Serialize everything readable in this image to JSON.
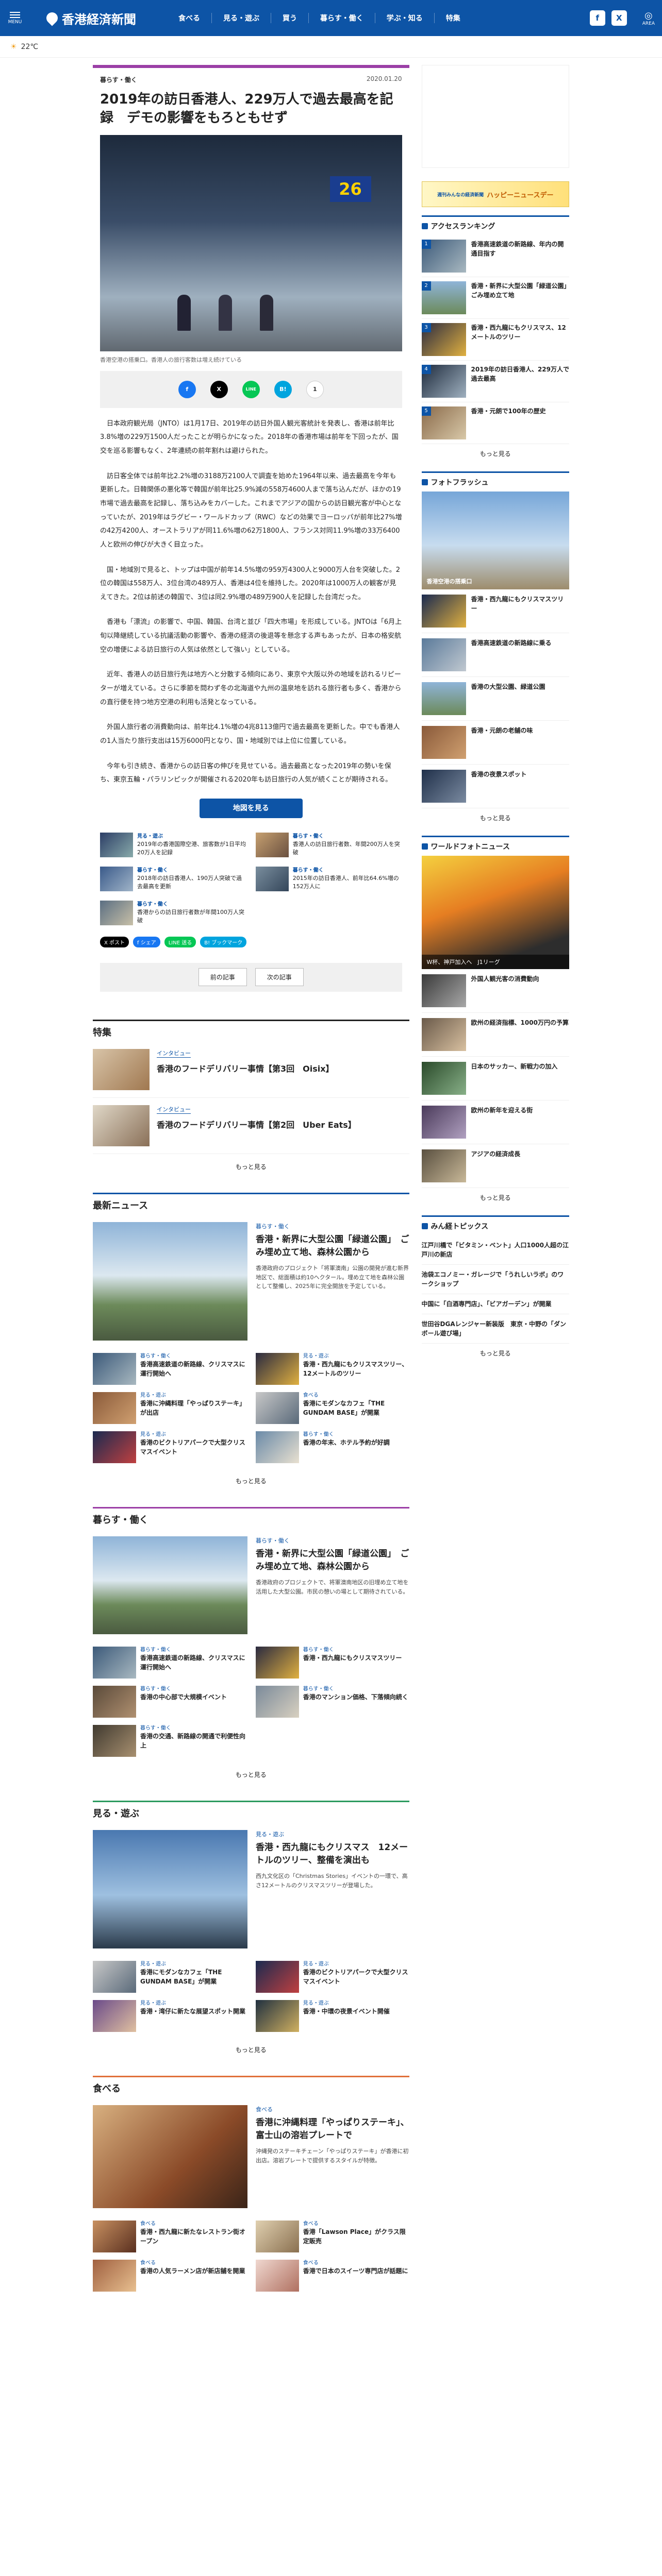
{
  "header": {
    "menu_label": "MENU",
    "site_name": "香港経済新聞",
    "nav": [
      "食べる",
      "見る・遊ぶ",
      "買う",
      "暮らす・働く",
      "学ぶ・知る",
      "特集"
    ],
    "area_label": "AREA"
  },
  "weather": {
    "temp": "22℃"
  },
  "article": {
    "category": "暮らす・働く",
    "date": "2020.01.20",
    "title": "2019年の訪日香港人、229万人で過去最高を記録　デモの影響をもろともせず",
    "caption": "香港空港の搭乗口。香港人の旅行客数は増え続けている",
    "gate_number": "26",
    "share": [
      "f",
      "X",
      "LINE",
      "B!",
      "1"
    ],
    "paragraphs": [
      "日本政府観光局（JNTO）は1月17日、2019年の訪日外国人観光客統計を発表し、香港は前年比3.8%増の229万1500人だったことが明らかになった。2018年の香港市場は前年を下回ったが、国交を巡る影響もなく、2年連続の前年割れは避けられた。",
      "訪日客全体では前年比2.2%増の3188万2100人で調査を始めた1964年以来、過去最高を今年も更新した。日韓関係の悪化等で韓国が前年比25.9%減の558万4600人まで落ち込んだが、ほかの19市場で過去最高を記録し、落ち込みをカバーした。これまでアジアの国からの訪日観光客が中心となっていたが、2019年はラグビー・ワールドカップ（RWC）などの効果でヨーロッパが前年比27%増の42万4200人、オーストラリアが同11.6%増の62万1800人、フランス対同11.9%増の33万6400人と欧州の伸びが大きく目立った。",
      "国・地域別で見ると、トップは中国が前年14.5%増の959万4300人と9000万人台を突破した。2位の韓国は558万人、3位台湾の489万人、香港は4位を維持した。2020年は1000万人の観客が見えてきた。2位は前述の韓国で、3位は同2.9%増の489万900人を記録した台湾だった。",
      "香港も「漂流」の影響で、中国、韓国、台湾と並び「四大市場」を形成している。JNTOは「6月上旬以降継続している抗議活動の影響や、香港の経済の後退等を懸念する声もあったが、日本の格安航空の増便による訪日旅行の人気は依然として強い」としている。",
      "近年、香港人の訪日旅行先は地方へと分散する傾向にあり、東京や大阪以外の地域を訪れるリピーターが増えている。さらに季節を問わず冬の北海道や九州の温泉地を訪れる旅行者も多く、香港からの直行便を持つ地方空港の利用も活発となっている。",
      "外国人旅行者の消費動向は、前年比4.1%増の4兆8113億円で過去最高を更新した。中でも香港人の1人当たり旅行支出は15万6000円となり、国・地域別では上位に位置している。",
      "今年も引き続き、香港からの訪日客の伸びを見せている。過去最高となった2019年の勢いを保ち、東京五輪・パラリンピックが開催される2020年も訪日旅行の人気が続くことが期待される。"
    ],
    "map_button": "地図を見る",
    "related": [
      {
        "k": "見る・遊ぶ",
        "t": "2019年の香港国際空港、旅客数が1日平均20万人を記録"
      },
      {
        "k": "暮らす・働く",
        "t": "香港人の訪日旅行者数、年間200万人を突破"
      },
      {
        "k": "暮らす・働く",
        "t": "2018年の訪日香港人、190万人突破で過去最高を更新"
      },
      {
        "k": "暮らす・働く",
        "t": "2015年の訪日香港人、前年比64.6%増の152万人に"
      },
      {
        "k": "暮らす・働く",
        "t": "香港からの訪日旅行者数が年間100万人突破"
      }
    ],
    "tags": [
      "X ポスト",
      "f シェア",
      "LINE 送る",
      "B! ブックマーク"
    ],
    "prev": "前の記事",
    "next": "次の記事"
  },
  "tokushu": {
    "title": "特集",
    "items": [
      {
        "kw": "インタビュー",
        "head": "香港のフードデリバリー事情【第3回　Oisix】"
      },
      {
        "kw": "インタビュー",
        "head": "香港のフードデリバリー事情【第2回　Uber Eats】"
      }
    ],
    "more": "もっと見る"
  },
  "latest": {
    "title": "最新ニュース",
    "lead": {
      "kw": "暮らす・働く",
      "head": "香港・新界に大型公園「緑道公園」　ごみ埋め立て地、森林公園から",
      "summary": "香港政府のプロジェクト「将軍澳南」公園の開発が進む新界地区で、総面積は約10ヘクタール。埋め立て地を森林公園として整備し、2025年に完全開放を予定している。"
    },
    "items": [
      {
        "k": "暮らす・働く",
        "t": "香港高速鉄道の新路線、クリスマスに運行開始へ"
      },
      {
        "k": "見る・遊ぶ",
        "t": "香港・西九龍にもクリスマスツリー、12メートルのツリー"
      },
      {
        "k": "見る・遊ぶ",
        "t": "香港に沖縄料理「やっぱりステーキ」が出店"
      },
      {
        "k": "食べる",
        "t": "香港にモダンなカフェ「THE GUNDAM BASE」が開業"
      },
      {
        "k": "見る・遊ぶ",
        "t": "香港のビクトリアパークで大型クリスマスイベント"
      },
      {
        "k": "暮らす・働く",
        "t": "香港の年末、ホテル予約が好調"
      }
    ],
    "more": "もっと見る"
  },
  "kurasu": {
    "title": "暮らす・働く",
    "lead": {
      "kw": "暮らす・働く",
      "head": "香港・新界に大型公園「緑道公園」　ごみ埋め立て地、森林公園から",
      "summary": "香港政府のプロジェクトで、将軍澳南地区の旧埋め立て地を活用した大型公園。市民の憩いの場として期待されている。"
    },
    "items": [
      {
        "k": "暮らす・働く",
        "t": "香港高速鉄道の新路線、クリスマスに運行開始へ"
      },
      {
        "k": "暮らす・働く",
        "t": "香港・西九龍にもクリスマスツリー"
      },
      {
        "k": "暮らす・働く",
        "t": "香港の中心部で大規模イベント"
      },
      {
        "k": "暮らす・働く",
        "t": "香港のマンション価格、下落傾向続く"
      },
      {
        "k": "暮らす・働く",
        "t": "香港の交通、新路線の開通で利便性向上"
      }
    ],
    "more": "もっと見る"
  },
  "miru": {
    "title": "見る・遊ぶ",
    "lead": {
      "kw": "見る・遊ぶ",
      "head": "香港・西九龍にもクリスマス　12メートルのツリー、整備を演出も",
      "summary": "西九文化区の「Christmas Stories」イベントの一環で、高さ12メートルのクリスマスツリーが登場した。"
    },
    "items": [
      {
        "k": "見る・遊ぶ",
        "t": "香港にモダンなカフェ「THE GUNDAM BASE」が開業"
      },
      {
        "k": "見る・遊ぶ",
        "t": "香港のビクトリアパークで大型クリスマスイベント"
      },
      {
        "k": "見る・遊ぶ",
        "t": "香港・湾仔に新たな展望スポット開業"
      },
      {
        "k": "見る・遊ぶ",
        "t": "香港・中環の夜景イベント開催"
      }
    ],
    "more": "もっと見る"
  },
  "taberu": {
    "title": "食べる",
    "lead": {
      "kw": "食べる",
      "head": "香港に沖縄料理「やっぱりステーキ」、富士山の溶岩プレートで",
      "summary": "沖縄発のステーキチェーン「やっぱりステーキ」が香港に初出店。溶岩プレートで提供するスタイルが特徴。"
    },
    "items": [
      {
        "k": "食べる",
        "t": "香港・西九龍に新たなレストラン街オープン"
      },
      {
        "k": "食べる",
        "t": "香港「Lawson Place」がクラス限定販売"
      },
      {
        "k": "食べる",
        "t": "香港の人気ラーメン店が新店舗を開業"
      },
      {
        "k": "食べる",
        "t": "香港で日本のスイーツ専門店が話題に"
      }
    ]
  },
  "sidebar": {
    "banner": "ハッピーニュースデー",
    "banner_sub": "週刊みんなの経済新聞",
    "ranking_title": "アクセスランキング",
    "ranking": [
      "香港高速鉄道の新路線、年内の開通目指す",
      "香港・新界に大型公園「緑道公園」　ごみ埋め立て地",
      "香港・西九龍にもクリスマス、12メートルのツリー",
      "2019年の訪日香港人、229万人で過去最高",
      "香港・元朗で100年の歴史"
    ],
    "ranking_more": "もっと見る",
    "photo_title": "フォトフラッシュ",
    "photo_caption": "香港空港の搭乗口",
    "photos": [
      "香港・西九龍にもクリスマスツリー",
      "香港高速鉄道の新路線に乗る",
      "香港の大型公園、緑道公園",
      "香港・元朗の老舗の味",
      "香港の夜景スポット"
    ],
    "photo_more": "もっと見る",
    "wf_title": "ワールドフォトニュース",
    "wf_caption": "W杯、神戸加入へ　J1リーグ",
    "wf_items": [
      "外国人観光客の消費動向",
      "欧州の経済指標、1000万円の予算",
      "日本のサッカー、新戦力の加入",
      "欧州の新年を迎える街",
      "アジアの経済成長"
    ],
    "wf_more": "もっと見る",
    "picks_title": "みん経トピックス",
    "picks": [
      "江戸川橋で「ビタミン・ベント」人口1000人超の江戸川の新店",
      "池袋エコノミー・ガレージで「うれしいラボ」のワークショップ",
      "中国に「白酒専門店」、「ビアガーデン」が開業",
      "世田谷DGAレンジャー新装版　東京・中野の「ダンボール遊び場」"
    ],
    "picks_more": "もっと見る"
  }
}
